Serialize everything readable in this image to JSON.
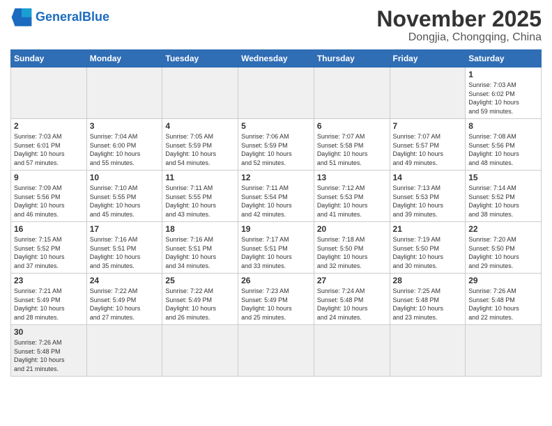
{
  "header": {
    "logo_general": "General",
    "logo_blue": "Blue",
    "title": "November 2025",
    "subtitle": "Dongjia, Chongqing, China"
  },
  "weekdays": [
    "Sunday",
    "Monday",
    "Tuesday",
    "Wednesday",
    "Thursday",
    "Friday",
    "Saturday"
  ],
  "weeks": [
    [
      {
        "day": "",
        "info": "",
        "empty": true
      },
      {
        "day": "",
        "info": "",
        "empty": true
      },
      {
        "day": "",
        "info": "",
        "empty": true
      },
      {
        "day": "",
        "info": "",
        "empty": true
      },
      {
        "day": "",
        "info": "",
        "empty": true
      },
      {
        "day": "",
        "info": "",
        "empty": true
      },
      {
        "day": "1",
        "info": "Sunrise: 7:03 AM\nSunset: 6:02 PM\nDaylight: 10 hours\nand 59 minutes."
      }
    ],
    [
      {
        "day": "2",
        "info": "Sunrise: 7:03 AM\nSunset: 6:01 PM\nDaylight: 10 hours\nand 57 minutes."
      },
      {
        "day": "3",
        "info": "Sunrise: 7:04 AM\nSunset: 6:00 PM\nDaylight: 10 hours\nand 55 minutes."
      },
      {
        "day": "4",
        "info": "Sunrise: 7:05 AM\nSunset: 5:59 PM\nDaylight: 10 hours\nand 54 minutes."
      },
      {
        "day": "5",
        "info": "Sunrise: 7:06 AM\nSunset: 5:59 PM\nDaylight: 10 hours\nand 52 minutes."
      },
      {
        "day": "6",
        "info": "Sunrise: 7:07 AM\nSunset: 5:58 PM\nDaylight: 10 hours\nand 51 minutes."
      },
      {
        "day": "7",
        "info": "Sunrise: 7:07 AM\nSunset: 5:57 PM\nDaylight: 10 hours\nand 49 minutes."
      },
      {
        "day": "8",
        "info": "Sunrise: 7:08 AM\nSunset: 5:56 PM\nDaylight: 10 hours\nand 48 minutes."
      }
    ],
    [
      {
        "day": "9",
        "info": "Sunrise: 7:09 AM\nSunset: 5:56 PM\nDaylight: 10 hours\nand 46 minutes."
      },
      {
        "day": "10",
        "info": "Sunrise: 7:10 AM\nSunset: 5:55 PM\nDaylight: 10 hours\nand 45 minutes."
      },
      {
        "day": "11",
        "info": "Sunrise: 7:11 AM\nSunset: 5:55 PM\nDaylight: 10 hours\nand 43 minutes."
      },
      {
        "day": "12",
        "info": "Sunrise: 7:11 AM\nSunset: 5:54 PM\nDaylight: 10 hours\nand 42 minutes."
      },
      {
        "day": "13",
        "info": "Sunrise: 7:12 AM\nSunset: 5:53 PM\nDaylight: 10 hours\nand 41 minutes."
      },
      {
        "day": "14",
        "info": "Sunrise: 7:13 AM\nSunset: 5:53 PM\nDaylight: 10 hours\nand 39 minutes."
      },
      {
        "day": "15",
        "info": "Sunrise: 7:14 AM\nSunset: 5:52 PM\nDaylight: 10 hours\nand 38 minutes."
      }
    ],
    [
      {
        "day": "16",
        "info": "Sunrise: 7:15 AM\nSunset: 5:52 PM\nDaylight: 10 hours\nand 37 minutes."
      },
      {
        "day": "17",
        "info": "Sunrise: 7:16 AM\nSunset: 5:51 PM\nDaylight: 10 hours\nand 35 minutes."
      },
      {
        "day": "18",
        "info": "Sunrise: 7:16 AM\nSunset: 5:51 PM\nDaylight: 10 hours\nand 34 minutes."
      },
      {
        "day": "19",
        "info": "Sunrise: 7:17 AM\nSunset: 5:51 PM\nDaylight: 10 hours\nand 33 minutes."
      },
      {
        "day": "20",
        "info": "Sunrise: 7:18 AM\nSunset: 5:50 PM\nDaylight: 10 hours\nand 32 minutes."
      },
      {
        "day": "21",
        "info": "Sunrise: 7:19 AM\nSunset: 5:50 PM\nDaylight: 10 hours\nand 30 minutes."
      },
      {
        "day": "22",
        "info": "Sunrise: 7:20 AM\nSunset: 5:50 PM\nDaylight: 10 hours\nand 29 minutes."
      }
    ],
    [
      {
        "day": "23",
        "info": "Sunrise: 7:21 AM\nSunset: 5:49 PM\nDaylight: 10 hours\nand 28 minutes."
      },
      {
        "day": "24",
        "info": "Sunrise: 7:22 AM\nSunset: 5:49 PM\nDaylight: 10 hours\nand 27 minutes."
      },
      {
        "day": "25",
        "info": "Sunrise: 7:22 AM\nSunset: 5:49 PM\nDaylight: 10 hours\nand 26 minutes."
      },
      {
        "day": "26",
        "info": "Sunrise: 7:23 AM\nSunset: 5:49 PM\nDaylight: 10 hours\nand 25 minutes."
      },
      {
        "day": "27",
        "info": "Sunrise: 7:24 AM\nSunset: 5:48 PM\nDaylight: 10 hours\nand 24 minutes."
      },
      {
        "day": "28",
        "info": "Sunrise: 7:25 AM\nSunset: 5:48 PM\nDaylight: 10 hours\nand 23 minutes."
      },
      {
        "day": "29",
        "info": "Sunrise: 7:26 AM\nSunset: 5:48 PM\nDaylight: 10 hours\nand 22 minutes."
      }
    ],
    [
      {
        "day": "30",
        "info": "Sunrise: 7:26 AM\nSunset: 5:48 PM\nDaylight: 10 hours\nand 21 minutes.",
        "last": true
      },
      {
        "day": "",
        "info": "",
        "empty": true,
        "last": true
      },
      {
        "day": "",
        "info": "",
        "empty": true,
        "last": true
      },
      {
        "day": "",
        "info": "",
        "empty": true,
        "last": true
      },
      {
        "day": "",
        "info": "",
        "empty": true,
        "last": true
      },
      {
        "day": "",
        "info": "",
        "empty": true,
        "last": true
      },
      {
        "day": "",
        "info": "",
        "empty": true,
        "last": true
      }
    ]
  ]
}
